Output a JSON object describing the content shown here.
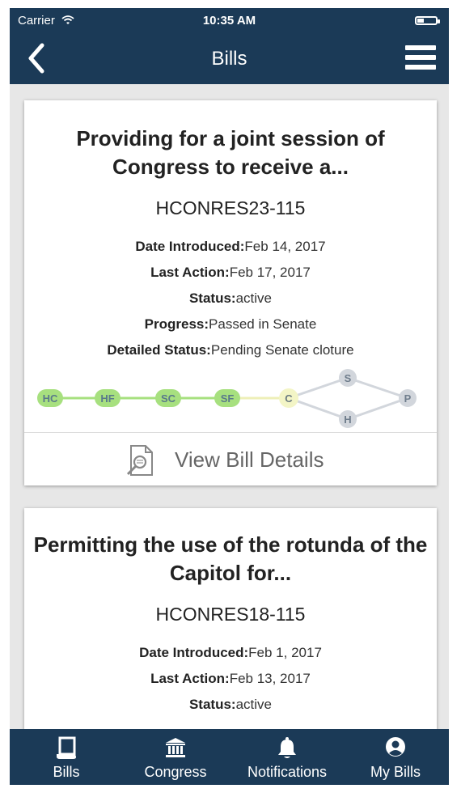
{
  "status_bar": {
    "carrier": "Carrier",
    "time": "10:35 AM",
    "battery_level": 0.35
  },
  "navbar": {
    "title": "Bills",
    "back_icon": "chevron-left-icon",
    "menu_icon": "hamburger-menu-icon"
  },
  "bills": [
    {
      "title": "Providing for a joint session of Congress to receive a...",
      "number": "HCONRES23-115",
      "date_introduced_label": "Date Introduced:",
      "date_introduced": "Feb 14, 2017",
      "last_action_label": "Last Action:",
      "last_action": "Feb 17, 2017",
      "status_label": "Status:",
      "status": "active",
      "progress_label": "Progress:",
      "progress": "Passed in Senate",
      "detailed_status_label": "Detailed Status:",
      "detailed_status": "Pending Senate cloture",
      "stages": [
        "HC",
        "HF",
        "SC",
        "SF",
        "C",
        "S",
        "H",
        "P"
      ],
      "completed_stages": [
        "HC",
        "HF",
        "SC",
        "SF"
      ],
      "current_stage": "C",
      "view_details_label": "View Bill Details"
    },
    {
      "title": "Permitting the use of the rotunda of the Capitol for...",
      "number": "HCONRES18-115",
      "date_introduced_label": "Date Introduced:",
      "date_introduced": "Feb 1, 2017",
      "last_action_label": "Last Action:",
      "last_action": "Feb 13, 2017",
      "status_label": "Status:",
      "status": "active"
    }
  ],
  "tabs": [
    {
      "label": "Bills",
      "icon": "scroll-icon"
    },
    {
      "label": "Congress",
      "icon": "capitol-building-icon"
    },
    {
      "label": "Notifications",
      "icon": "bell-icon"
    },
    {
      "label": "My Bills",
      "icon": "user-circle-icon"
    }
  ],
  "colors": {
    "nav_background": "#1b3a57",
    "stage_complete": "#a7e07f",
    "stage_current": "#f3f5c6",
    "stage_pending": "#d2d6dc"
  }
}
